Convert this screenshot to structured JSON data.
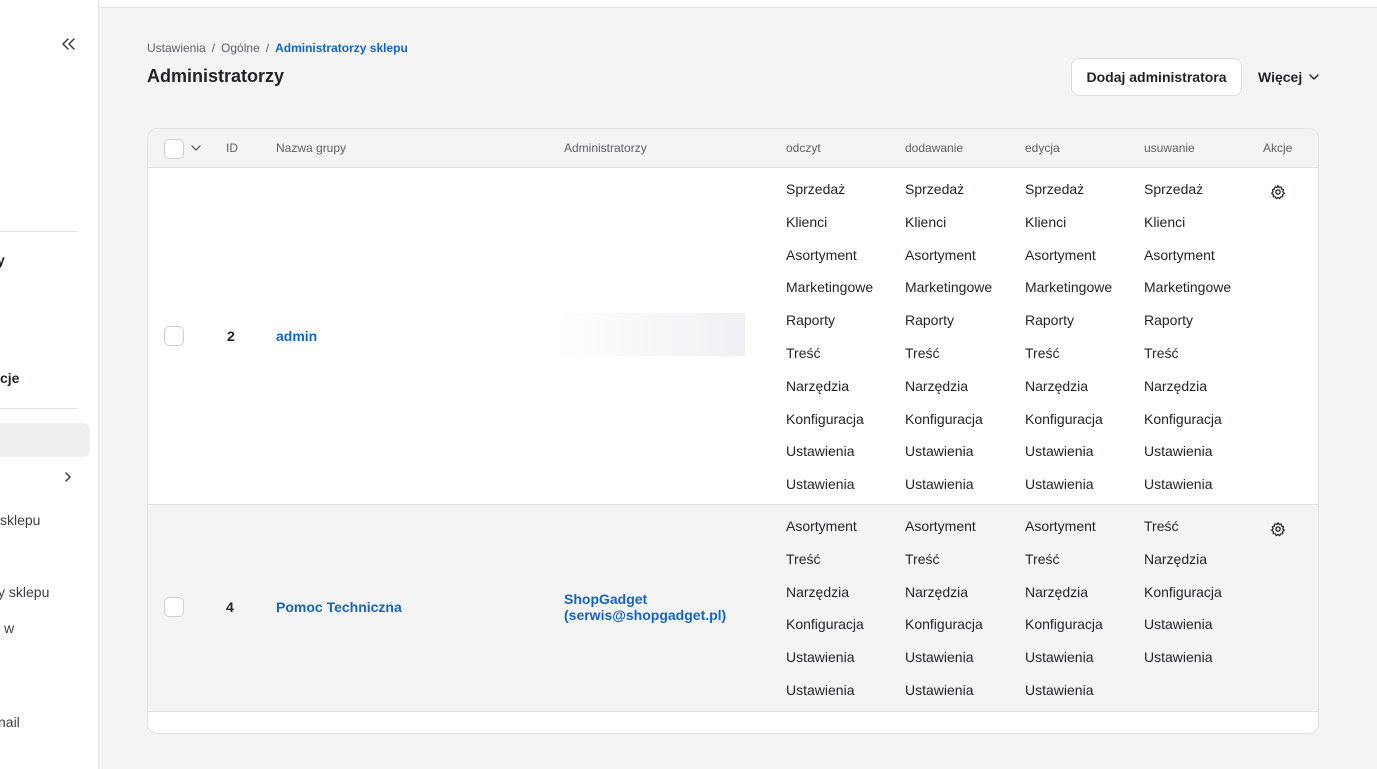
{
  "sidebar": {
    "items": [
      {
        "label": "y"
      },
      {
        "label": "cje"
      },
      {
        "label": "sklepu"
      },
      {
        "label": "y sklepu"
      },
      {
        "label": "w"
      },
      {
        "label": "nail"
      }
    ]
  },
  "breadcrumb": {
    "items": [
      "Ustawienia",
      "Ogólne",
      "Administratorzy sklepu"
    ],
    "separator": "/"
  },
  "page": {
    "title": "Administratorzy"
  },
  "toolbar": {
    "add_label": "Dodaj administratora",
    "more_label": "Więcej"
  },
  "table": {
    "columns": {
      "id": "ID",
      "group": "Nazwa grupy",
      "admins": "Administratorzy",
      "read": "odczyt",
      "add": "dodawanie",
      "edit": "edycja",
      "delete": "usuwanie",
      "actions": "Akcje"
    },
    "rows": [
      {
        "id": "2",
        "group": "admin",
        "admins": "",
        "read": [
          "Sprzedaż",
          "Klienci",
          "Asortyment",
          "Marketingowe",
          "Raporty",
          "Treść",
          "Narzędzia",
          "Konfiguracja",
          "Ustawienia",
          "Ustawienia"
        ],
        "add": [
          "Sprzedaż",
          "Klienci",
          "Asortyment",
          "Marketingowe",
          "Raporty",
          "Treść",
          "Narzędzia",
          "Konfiguracja",
          "Ustawienia",
          "Ustawienia"
        ],
        "edit": [
          "Sprzedaż",
          "Klienci",
          "Asortyment",
          "Marketingowe",
          "Raporty",
          "Treść",
          "Narzędzia",
          "Konfiguracja",
          "Ustawienia",
          "Ustawienia"
        ],
        "delete": [
          "Sprzedaż",
          "Klienci",
          "Asortyment",
          "Marketingowe",
          "Raporty",
          "Treść",
          "Narzędzia",
          "Konfiguracja",
          "Ustawienia",
          "Ustawienia"
        ]
      },
      {
        "id": "4",
        "group": "Pomoc Techniczna",
        "admins_line1": "ShopGadget",
        "admins_line2": "(serwis@shopgadget.pl)",
        "read": [
          "Asortyment",
          "Treść",
          "Narzędzia",
          "Konfiguracja",
          "Ustawienia",
          "Ustawienia"
        ],
        "add": [
          "Asortyment",
          "Treść",
          "Narzędzia",
          "Konfiguracja",
          "Ustawienia",
          "Ustawienia"
        ],
        "edit": [
          "Asortyment",
          "Treść",
          "Narzędzia",
          "Konfiguracja",
          "Ustawienia",
          "Ustawienia"
        ],
        "delete": [
          "Treść",
          "Narzędzia",
          "Konfiguracja",
          "Ustawienia",
          "Ustawienia"
        ]
      }
    ]
  },
  "colors": {
    "accent": "#1565c0",
    "background": "#f4f4f5",
    "border": "#e3e4e6"
  },
  "icons": [
    "collapse-sidebar-icon",
    "chevron-right-icon",
    "chevron-down-icon",
    "gear-icon"
  ]
}
